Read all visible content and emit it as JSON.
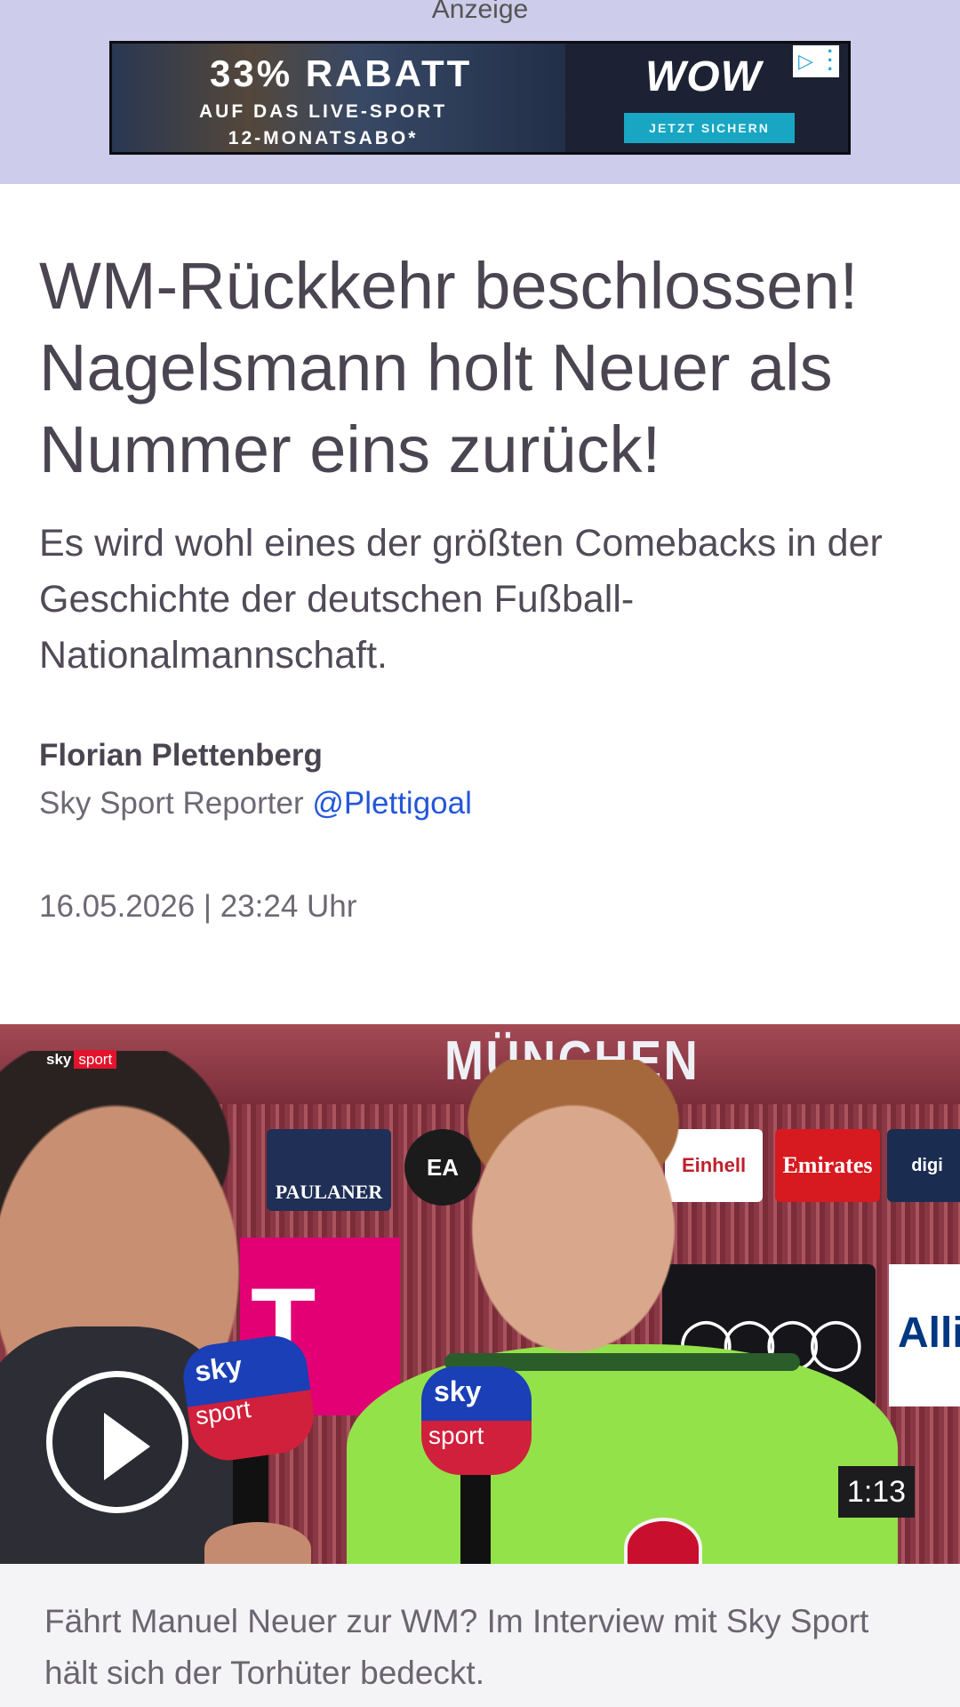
{
  "ad": {
    "label": "Anzeige",
    "headline": "33% RABATT",
    "subline1": "AUF DAS LIVE-SPORT",
    "subline2": "12-MONATSABO*",
    "brand": "WOW",
    "cta": "JETZT SICHERN"
  },
  "article": {
    "headline": "WM-Rückkehr beschlossen! Nagelsmann holt Neuer als Nummer eins zurück!",
    "standfirst": "Es wird wohl eines der größten Comebacks in der Geschichte der deutschen Fußball-Nationalmannschaft.",
    "author": "Florian Plettenberg",
    "role": "Sky Sport Reporter",
    "handle": "@Plettigoal",
    "date": "16.05.2026 | 23:24 Uhr"
  },
  "video": {
    "channel_logo_1": "sky",
    "channel_logo_2": "sport",
    "stadium_text": "MÜNCHEN",
    "boards": {
      "paulaner": "PAULANER",
      "ea": "EA",
      "einhell": "Einhell",
      "emirates": "Emirates",
      "digi": "digi",
      "telekom": "T",
      "allianz": "Alli"
    },
    "mic_label_1": "sky",
    "mic_label_2": "sport",
    "duration": "1:13",
    "caption": "Fährt Manuel Neuer zur WM? Im Interview mit Sky Sport hält sich der Torhüter bedeckt."
  },
  "colors": {
    "ad_background": "#cdccea",
    "link": "#2356d9",
    "text_primary": "#4a4550",
    "caption_background": "#f4f4f6"
  }
}
